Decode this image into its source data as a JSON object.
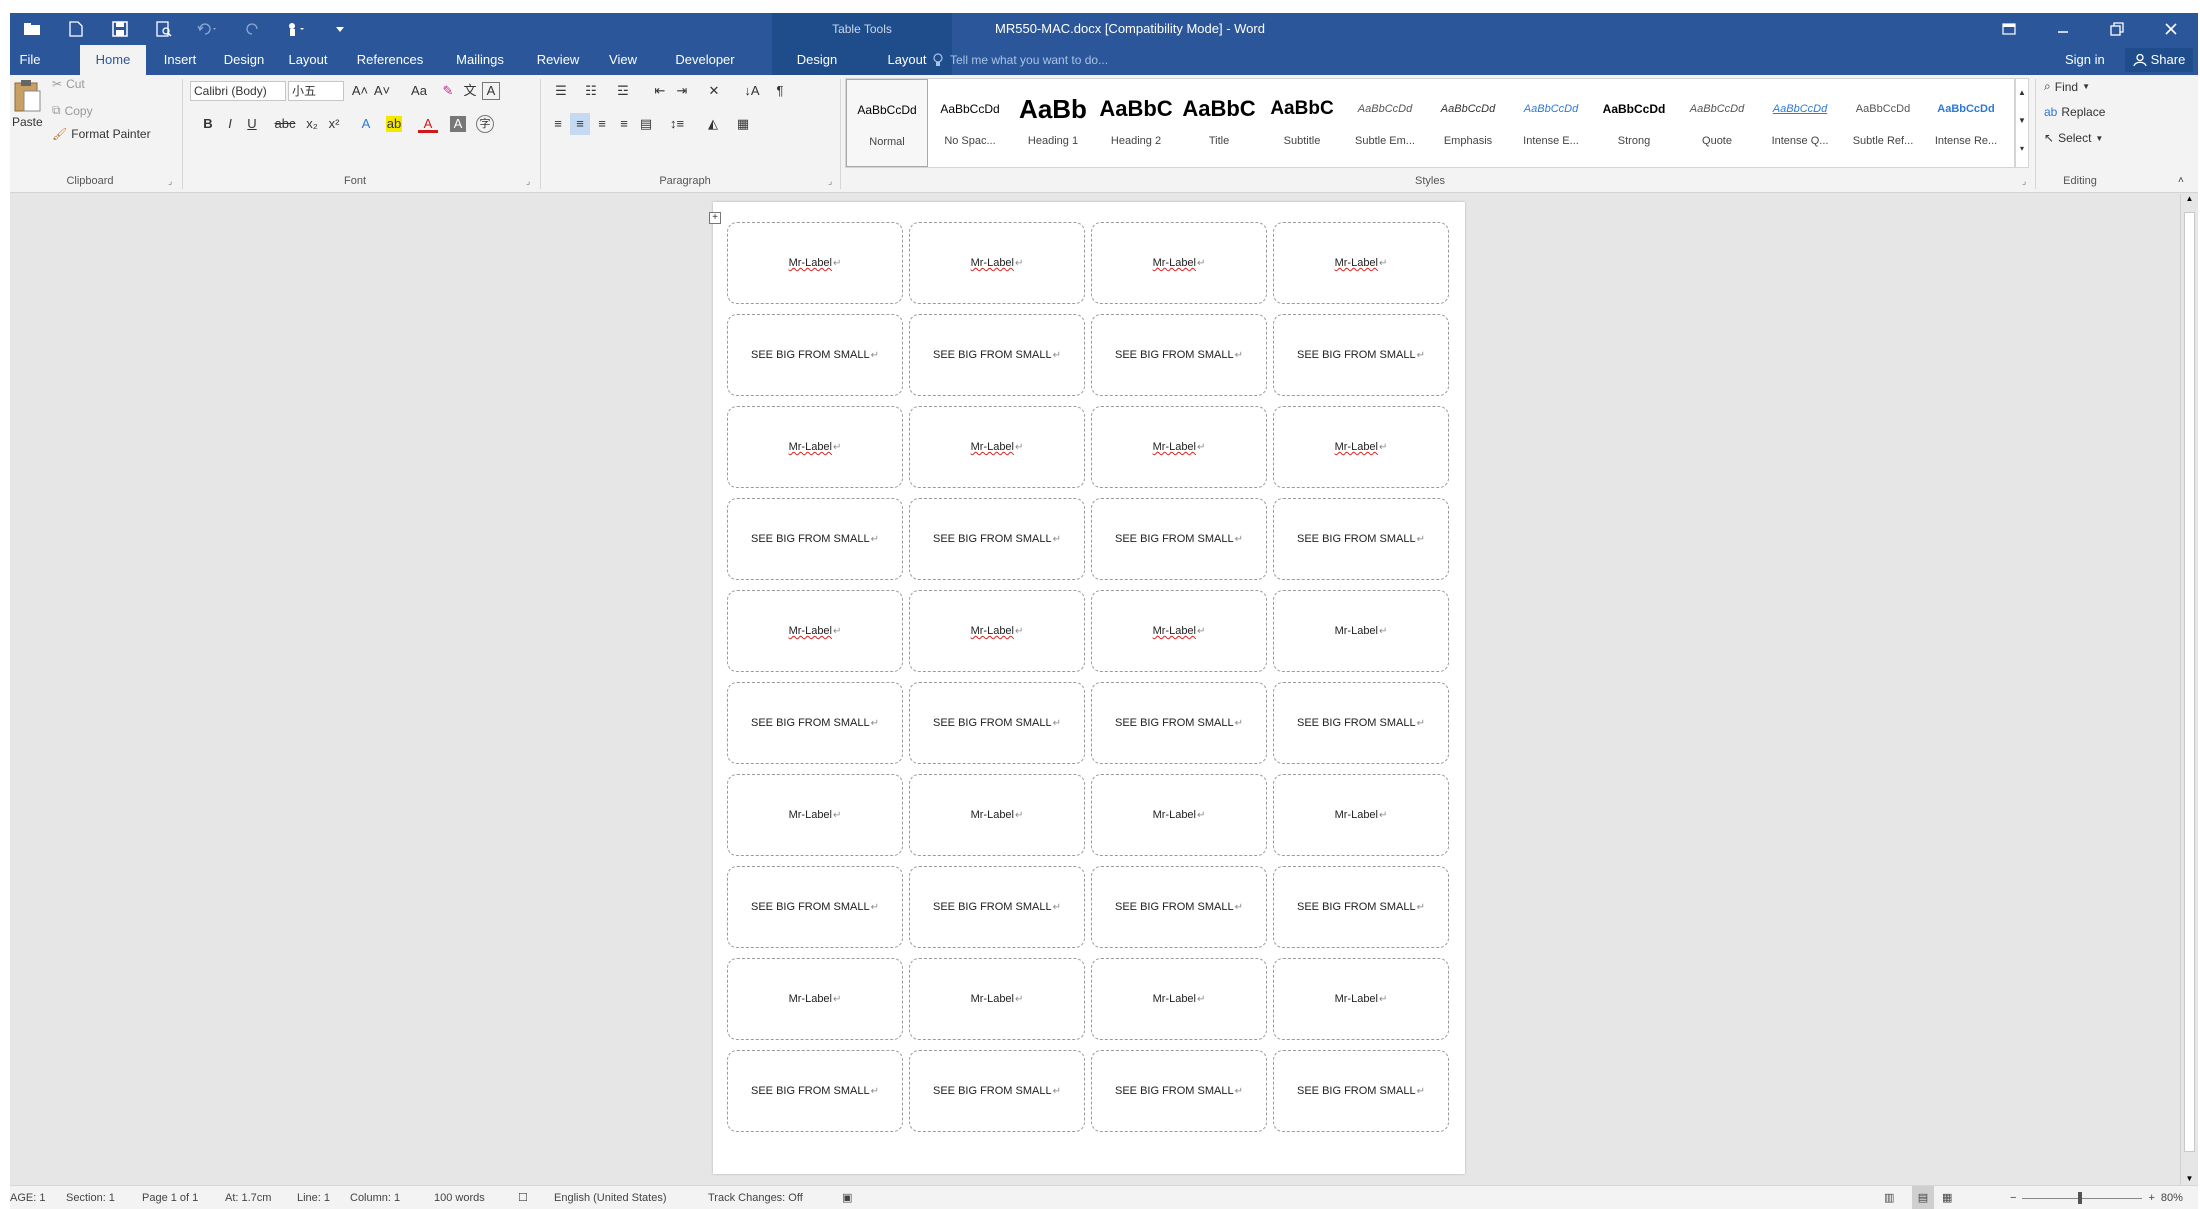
{
  "window": {
    "doc_title": "MR550-MAC.docx [Compatibility Mode] - Word",
    "context_tab_group": "Table Tools"
  },
  "tabs": [
    {
      "label": "File"
    },
    {
      "label": "Home"
    },
    {
      "label": "Insert"
    },
    {
      "label": "Design"
    },
    {
      "label": "Layout"
    },
    {
      "label": "References"
    },
    {
      "label": "Mailings"
    },
    {
      "label": "Review"
    },
    {
      "label": "View"
    },
    {
      "label": "Developer"
    },
    {
      "label": "Design"
    },
    {
      "label": "Layout"
    }
  ],
  "tell_me": "Tell me what you want to do...",
  "account": {
    "sign_in": "Sign in",
    "share": "Share"
  },
  "clipboard": {
    "paste": "Paste",
    "cut": "Cut",
    "copy": "Copy",
    "format_painter": "Format Painter",
    "group": "Clipboard"
  },
  "font": {
    "font_name": "Calibri (Body)",
    "font_size": "小五",
    "change_case": "Aa",
    "group": "Font"
  },
  "paragraph": {
    "group": "Paragraph"
  },
  "styles": {
    "group": "Styles",
    "items": [
      {
        "sample": "AaBbCcDd",
        "name": "Normal"
      },
      {
        "sample": "AaBbCcDd",
        "name": "No Spac..."
      },
      {
        "sample": "AaBb",
        "name": "Heading 1"
      },
      {
        "sample": "AaBbC",
        "name": "Heading 2"
      },
      {
        "sample": "AaBbC",
        "name": "Title"
      },
      {
        "sample": "AaBbC",
        "name": "Subtitle"
      },
      {
        "sample": "AaBbCcDd",
        "name": "Subtle Em..."
      },
      {
        "sample": "AaBbCcDd",
        "name": "Emphasis"
      },
      {
        "sample": "AaBbCcDd",
        "name": "Intense E..."
      },
      {
        "sample": "AaBbCcDd",
        "name": "Strong"
      },
      {
        "sample": "AaBbCcDd",
        "name": "Quote"
      },
      {
        "sample": "AaBbCcDd",
        "name": "Intense Q..."
      },
      {
        "sample": "AaBbCcDd",
        "name": "Subtle Ref..."
      },
      {
        "sample": "AaBbCcDd",
        "name": "Intense Re..."
      }
    ]
  },
  "editing": {
    "find": "Find",
    "replace": "Replace",
    "select": "Select",
    "group": "Editing"
  },
  "labels": {
    "name_text": "Mr-Label",
    "slogan_text": "SEE BIG FROM SMALL",
    "rows": [
      {
        "text": "Mr-Label",
        "spell": true
      },
      {
        "text": "SEE BIG FROM SMALL",
        "spell": false
      },
      {
        "text": "Mr-Label",
        "spell": true
      },
      {
        "text": "SEE BIG FROM SMALL",
        "spell": false
      },
      {
        "text": "Mr-Label",
        "spell": "partial"
      },
      {
        "text": "SEE BIG FROM SMALL",
        "spell": false
      },
      {
        "text": "Mr-Label",
        "spell": false
      },
      {
        "text": "SEE BIG FROM SMALL",
        "spell": false
      },
      {
        "text": "Mr-Label",
        "spell": false
      },
      {
        "text": "SEE BIG FROM SMALL",
        "spell": false
      }
    ]
  },
  "statusbar": {
    "page": "AGE: 1",
    "section": "Section: 1",
    "page_of": "Page 1 of 1",
    "at": "At: 1.7cm",
    "line": "Line: 1",
    "column": "Column: 1",
    "words": "100 words",
    "language": "English (United States)",
    "track_changes": "Track Changes: Off",
    "zoom": "80%"
  },
  "colors": {
    "accent": "#2b579a",
    "ribbon_bg": "#f3f3f3",
    "canvas_bg": "#e6e6e6"
  }
}
